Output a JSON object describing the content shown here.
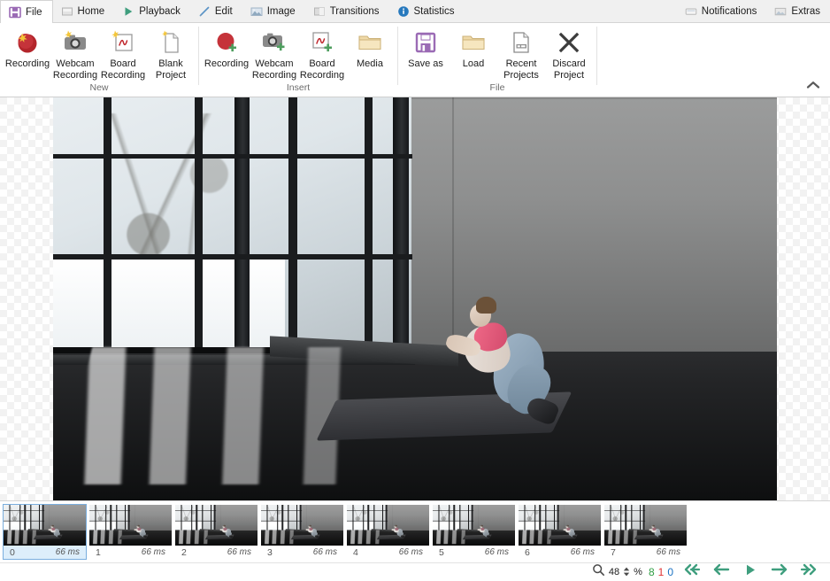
{
  "tabs": {
    "left": [
      {
        "id": "file",
        "label": "File",
        "icon": "save-icon",
        "active": true
      },
      {
        "id": "home",
        "label": "Home",
        "icon": "home-icon",
        "active": false
      },
      {
        "id": "playback",
        "label": "Playback",
        "icon": "play-icon",
        "active": false
      },
      {
        "id": "edit",
        "label": "Edit",
        "icon": "pencil-icon",
        "active": false
      },
      {
        "id": "image",
        "label": "Image",
        "icon": "picture-icon",
        "active": false
      },
      {
        "id": "transitions",
        "label": "Transitions",
        "icon": "transitions-icon",
        "active": false
      },
      {
        "id": "statistics",
        "label": "Statistics",
        "icon": "info-icon",
        "active": false
      }
    ],
    "right": [
      {
        "id": "notifications",
        "label": "Notifications",
        "icon": "notification-icon"
      },
      {
        "id": "extras",
        "label": "Extras",
        "icon": "extras-icon"
      }
    ]
  },
  "ribbon": {
    "collapse_icon": "chevron-up-icon",
    "groups": [
      {
        "id": "new",
        "title": "New",
        "items": [
          {
            "id": "new-recording",
            "label": "Recording",
            "icon": "record-dot-icon"
          },
          {
            "id": "new-webcam-recording",
            "label": "Webcam\nRecording",
            "icon": "webcam-icon"
          },
          {
            "id": "new-board-recording",
            "label": "Board\nRecording",
            "icon": "board-icon"
          },
          {
            "id": "new-blank-project",
            "label": "Blank\nProject",
            "icon": "blank-page-icon"
          }
        ]
      },
      {
        "id": "insert",
        "title": "Insert",
        "items": [
          {
            "id": "insert-recording",
            "label": "Recording",
            "icon": "record-dot-plus-icon"
          },
          {
            "id": "insert-webcam-recording",
            "label": "Webcam\nRecording",
            "icon": "webcam-plus-icon"
          },
          {
            "id": "insert-board-recording",
            "label": "Board\nRecording",
            "icon": "board-plus-icon"
          },
          {
            "id": "insert-media",
            "label": "Media",
            "icon": "folder-icon"
          }
        ]
      },
      {
        "id": "file",
        "title": "File",
        "items": [
          {
            "id": "save-as",
            "label": "Save as",
            "icon": "floppy-icon"
          },
          {
            "id": "load",
            "label": "Load",
            "icon": "folder-icon"
          },
          {
            "id": "recent-projects",
            "label": "Recent\nProjects",
            "icon": "recent-doc-icon"
          },
          {
            "id": "discard-project",
            "label": "Discard\nProject",
            "icon": "x-icon"
          }
        ]
      }
    ]
  },
  "filmstrip": {
    "frames": [
      {
        "index": "0",
        "duration": "66 ms",
        "selected": true
      },
      {
        "index": "1",
        "duration": "66 ms",
        "selected": false
      },
      {
        "index": "2",
        "duration": "66 ms",
        "selected": false
      },
      {
        "index": "3",
        "duration": "66 ms",
        "selected": false
      },
      {
        "index": "4",
        "duration": "66 ms",
        "selected": false
      },
      {
        "index": "5",
        "duration": "66 ms",
        "selected": false
      },
      {
        "index": "6",
        "duration": "66 ms",
        "selected": false
      },
      {
        "index": "7",
        "duration": "66 ms",
        "selected": false
      }
    ]
  },
  "statusbar": {
    "zoom_icon": "magnifier-icon",
    "zoom_value": "48",
    "zoom_unit": "%",
    "counts": {
      "green": "8",
      "red": "1",
      "blue": "0"
    },
    "nav": [
      {
        "id": "first-frame",
        "icon": "skip-back-icon"
      },
      {
        "id": "previous-frame",
        "icon": "arrow-left-icon"
      },
      {
        "id": "play",
        "icon": "play-triangle-icon"
      },
      {
        "id": "next-frame",
        "icon": "arrow-right-icon"
      },
      {
        "id": "last-frame",
        "icon": "skip-forward-icon"
      }
    ]
  },
  "colors": {
    "accent_purple": "#9b6bb5",
    "record_red": "#c0272d",
    "nav_green": "#3f9e7e",
    "selection_blue": "#7aaede",
    "count_green": "#2f9e44",
    "count_red": "#e03131",
    "count_blue": "#1971c2"
  }
}
